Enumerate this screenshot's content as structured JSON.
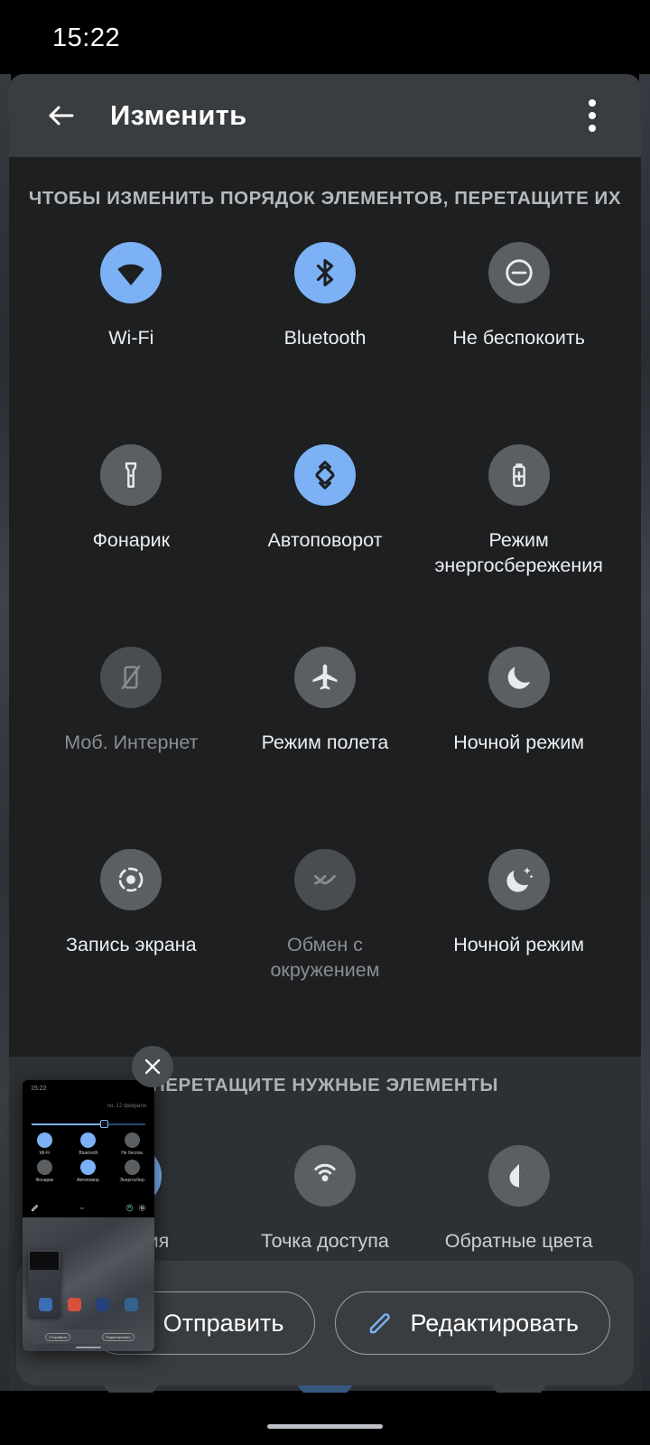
{
  "statusbar": {
    "clock": "15:22"
  },
  "appbar": {
    "title": "Изменить",
    "back_icon": "arrow-back-icon",
    "overflow_icon": "more-vert-icon"
  },
  "current_section": {
    "header": "ЧТОБЫ ИЗМЕНИТЬ ПОРЯДОК ЭЛЕМЕНТОВ, ПЕРЕТАЩИТЕ ИХ",
    "tiles": [
      {
        "label": "Wi-Fi",
        "icon": "wifi-icon",
        "state": "on"
      },
      {
        "label": "Bluetooth",
        "icon": "bluetooth-icon",
        "state": "on"
      },
      {
        "label": "Не беспокоить",
        "icon": "do-not-disturb-icon",
        "state": "off"
      },
      {
        "label": "Фонарик",
        "icon": "flashlight-icon",
        "state": "off"
      },
      {
        "label": "Автоповорот",
        "icon": "auto-rotate-icon",
        "state": "on"
      },
      {
        "label": "Режим энергосбережения",
        "icon": "battery-saver-icon",
        "state": "off"
      },
      {
        "label": "Моб. Интернет",
        "icon": "mobile-data-off-icon",
        "state": "dim"
      },
      {
        "label": "Режим полета",
        "icon": "airplane-icon",
        "state": "off"
      },
      {
        "label": "Ночной режим",
        "icon": "moon-icon",
        "state": "off"
      },
      {
        "label": "Запись экрана",
        "icon": "screen-record-icon",
        "state": "off"
      },
      {
        "label": "Обмен с окружением",
        "icon": "nearby-share-icon",
        "state": "dim"
      },
      {
        "label": "Ночной режим",
        "icon": "night-light-icon",
        "state": "off"
      }
    ]
  },
  "available_section": {
    "header": "ПЕРЕТАЩИТЕ НУЖНЫЕ ЭЛЕМЕНТЫ",
    "tiles": [
      {
        "label": "Локация",
        "icon": "location-icon",
        "state": "on"
      },
      {
        "label": "Точка доступа",
        "icon": "hotspot-icon",
        "state": "off"
      },
      {
        "label": "Обратные цвета",
        "icon": "invert-colors-icon",
        "state": "off"
      }
    ],
    "clipped_tiles": [
      {
        "label": "",
        "icon": "circle-icon",
        "state": "off"
      },
      {
        "label": "",
        "icon": "dark-theme-icon",
        "state": "on"
      },
      {
        "label": "",
        "icon": "cast-icon",
        "state": "off"
      }
    ]
  },
  "preview": {
    "close_icon": "close-icon",
    "clock": "15:22",
    "date": "пн, 12 февраля",
    "tiles": [
      {
        "label": "Wi-Fi",
        "state": "on"
      },
      {
        "label": "Bluetooth",
        "state": "on"
      },
      {
        "label": "Не беспок.",
        "state": "off"
      },
      {
        "label": "Фонарик",
        "state": "off"
      },
      {
        "label": "Автоповор.",
        "state": "on"
      },
      {
        "label": "Энергосбер.",
        "state": "off"
      }
    ],
    "nested_share_label": "Отправить",
    "nested_edit_label": "Редактировать"
  },
  "actionbar": {
    "share_label": "Отправить",
    "share_icon": "share-icon",
    "edit_label": "Редактировать",
    "edit_icon": "edit-pencil-icon"
  },
  "colors": {
    "accent": "#7cb2f5",
    "tile_off": "#5c5f62",
    "panel_top_bg": "#1d1f21",
    "panel_bottom_bg": "#2e3134",
    "appbar_bg": "#3a3d40"
  }
}
